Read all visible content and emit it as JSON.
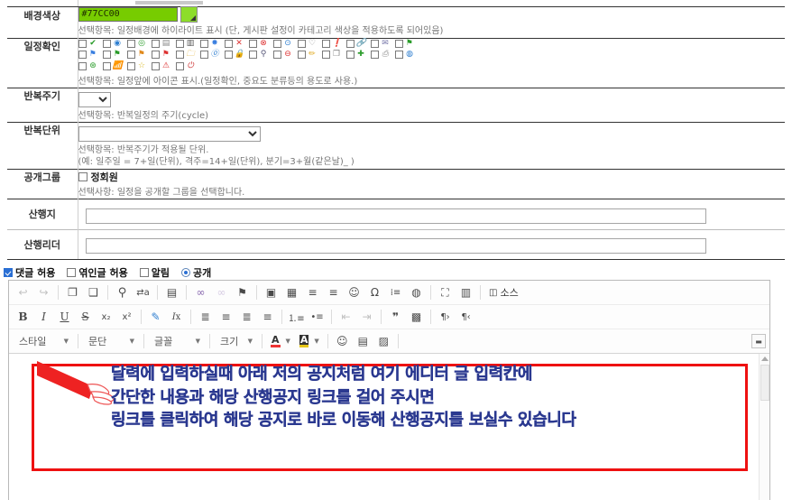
{
  "form": {
    "rows": [
      {
        "label": "배경색상",
        "type": "color",
        "value": "#77CC00",
        "hint": [
          "선택항목: 일정배경에 하이라이트 표시 (단, 게시판 설정이 카테고리 색상을 적용하도록 되어있음)"
        ]
      },
      {
        "label": "일정확인",
        "type": "icons",
        "hint": [
          "선택항목: 일정앞에 아이콘 표시.(일정확인, 중요도 분류등의 용도로 사용.)"
        ]
      },
      {
        "label": "반복주기",
        "type": "select-small",
        "value": "",
        "hint": [
          "선택항목: 반복일정의 주기(cycle)"
        ]
      },
      {
        "label": "반복단위",
        "type": "select-large",
        "value": "",
        "hint": [
          "선택항목: 반복주기가 적용될 단위.",
          "(예: 일주일 = 7+일(단위), 격주=14+일(단위), 분기=3+월(같은날)_ )"
        ]
      },
      {
        "label": "공개그룹",
        "type": "checkbox",
        "checkbox_label": "정회원",
        "hint": [
          "선택사항: 일정을 공개할 그룹을 선택합니다."
        ]
      },
      {
        "label": "산행지",
        "type": "text",
        "value": "",
        "hint": []
      },
      {
        "label": "산행리더",
        "type": "text",
        "value": "",
        "hint": []
      }
    ],
    "icon_grid": {
      "row1": [
        "check-green-icon",
        "circle-blue-icon",
        "circle-green-icon",
        "page-icon",
        "chart-icon",
        "star-blue-icon",
        "x-red-icon",
        "stop-red-icon",
        "info-blue-icon",
        "balloon-icon",
        "exclaim-green-icon",
        "link-icon",
        "mail-icon",
        "flag-green-icon"
      ],
      "row2": [
        "flag-blue-icon",
        "flag-green2-icon",
        "flag-orange-icon",
        "flag-red-icon",
        "folder-icon",
        "info2-icon",
        "lock-icon",
        "search-icon",
        "minus-red-icon",
        "pencil-icon",
        "copy-icon",
        "plus-green-icon",
        "print-icon",
        "globe-icon"
      ],
      "row3": [
        "money-icon",
        "rss-icon",
        "star-icon",
        "warning-icon",
        "power-icon"
      ]
    },
    "options": [
      {
        "name": "allow-comments",
        "label": "댓글 허용",
        "control": "checkbox",
        "checked": true
      },
      {
        "name": "allow-trackback",
        "label": "엮인글 허용",
        "control": "checkbox",
        "checked": false
      },
      {
        "name": "notify",
        "label": "알림",
        "control": "checkbox",
        "checked": false
      },
      {
        "name": "public",
        "label": "공개",
        "control": "radio",
        "checked": true
      }
    ]
  },
  "editor": {
    "toolbar_row1": [
      {
        "name": "undo-icon",
        "glyph": "↩",
        "dim": true
      },
      {
        "name": "redo-icon",
        "glyph": "↪",
        "dim": true
      },
      {
        "sep": true
      },
      {
        "name": "paste-icon",
        "glyph": "❐"
      },
      {
        "name": "paste-text-icon",
        "glyph": "❑"
      },
      {
        "sep": true
      },
      {
        "name": "find-icon",
        "glyph": "⚲"
      },
      {
        "name": "replace-icon",
        "glyph": "⇆"
      },
      {
        "sep": true
      },
      {
        "name": "select-all-icon",
        "glyph": "▤"
      },
      {
        "sep": true
      },
      {
        "name": "link-icon",
        "glyph": "⛓"
      },
      {
        "name": "unlink-icon",
        "glyph": "⛓",
        "dim": true
      },
      {
        "name": "anchor-icon",
        "glyph": "⚑"
      },
      {
        "sep": true
      },
      {
        "name": "image-icon",
        "glyph": "▣"
      },
      {
        "name": "table-icon",
        "glyph": "▦"
      },
      {
        "name": "horizontal-rule-icon",
        "glyph": "▬"
      },
      {
        "name": "page-break-icon",
        "glyph": "▤"
      },
      {
        "name": "smiley-icon",
        "glyph": "☺"
      },
      {
        "name": "special-char-icon",
        "glyph": "Ω"
      },
      {
        "name": "numbered-list-icon",
        "glyph": "⁞≡"
      },
      {
        "name": "iframe-icon",
        "glyph": "◍"
      },
      {
        "sep": true
      },
      {
        "name": "maximize-icon",
        "glyph": "⛶"
      },
      {
        "name": "show-blocks-icon",
        "glyph": "▥"
      },
      {
        "sep": true
      }
    ],
    "source_label": "소스",
    "source_icon": "source-icon",
    "toolbar_row2": [
      {
        "name": "bold-icon",
        "glyph": "B",
        "style": "bold"
      },
      {
        "name": "italic-icon",
        "glyph": "I",
        "style": "italic"
      },
      {
        "name": "underline-icon",
        "glyph": "U",
        "style": "underline"
      },
      {
        "name": "strike-icon",
        "glyph": "S",
        "style": "strike"
      },
      {
        "name": "subscript-icon",
        "glyph": "x₂"
      },
      {
        "name": "superscript-icon",
        "glyph": "x²"
      },
      {
        "sep": true
      },
      {
        "name": "remove-format-icon",
        "glyph": "🖌"
      },
      {
        "name": "clear-format-icon",
        "glyph": "Ix"
      },
      {
        "sep": true
      },
      {
        "name": "align-left-icon",
        "glyph": "≣"
      },
      {
        "name": "align-center-icon",
        "glyph": "≡"
      },
      {
        "name": "align-right-icon",
        "glyph": "≣"
      },
      {
        "name": "align-justify-icon",
        "glyph": "≡"
      },
      {
        "sep": true
      },
      {
        "name": "ordered-list-icon",
        "glyph": "⒈≡"
      },
      {
        "name": "unordered-list-icon",
        "glyph": "•≡"
      },
      {
        "sep": true
      },
      {
        "name": "outdent-icon",
        "glyph": "⇤",
        "dim": true
      },
      {
        "name": "indent-icon",
        "glyph": "⇥",
        "dim": true
      },
      {
        "sep": true
      },
      {
        "name": "blockquote-icon",
        "glyph": "❞"
      },
      {
        "name": "div-container-icon",
        "glyph": "▩"
      },
      {
        "sep": true
      },
      {
        "name": "text-direction-ltr-icon",
        "glyph": "¶›"
      },
      {
        "name": "text-direction-rtl-icon",
        "glyph": "¶‹"
      }
    ],
    "toolbar_row3": {
      "combos": [
        {
          "name": "style-combo",
          "label": "스타일"
        },
        {
          "name": "format-combo",
          "label": "문단"
        },
        {
          "name": "font-combo",
          "label": "글꼴"
        },
        {
          "name": "fontsize-combo",
          "label": "크기"
        }
      ],
      "buttons": [
        {
          "name": "text-color-icon",
          "glyph": "A"
        },
        {
          "name": "background-color-icon",
          "glyph": "A"
        },
        {
          "name": "smiley2-icon",
          "glyph": "☺"
        },
        {
          "name": "image2-icon",
          "glyph": "▤"
        },
        {
          "name": "flash-icon",
          "glyph": "▨"
        }
      ],
      "collapse_icon": "collapse-toolbar-icon"
    },
    "content": {
      "lines": [
        "달력에 입력하실때 아래 저의 공지처럼 여기 에디터 글 입력칸에",
        "간단한 내용과 해당 산행공지 링크를 걸어 주시면",
        "링크를 클릭하여 해당 공지로 바로 이동해 산행공지를 보실수 있습니다"
      ],
      "text_color": "#2b3990",
      "border_color": "#ee1111",
      "arrow_color": "#ee2222"
    }
  }
}
